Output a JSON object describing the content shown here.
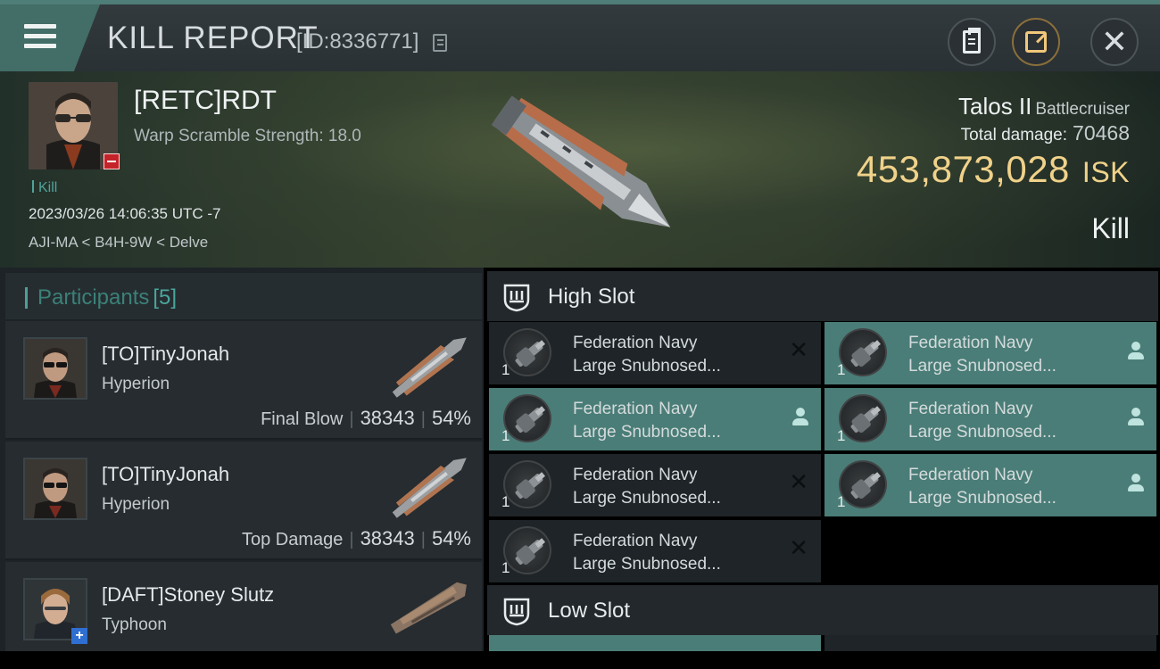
{
  "window": {
    "title": "KILL REPORT",
    "id_text": "[ID:8336771]"
  },
  "killmail": {
    "victim_name": "[RETC]RDT",
    "warp_scramble": "Warp Scramble Strength: 18.0",
    "kill_label": "Kill",
    "datetime": "2023/03/26 14:06:35 UTC -7",
    "location": "AJI-MA < B4H-9W < Delve",
    "ship_name": "Talos II",
    "ship_class": "Battlecruiser",
    "total_damage_label": "Total damage:",
    "total_damage": "70468",
    "isk_value": "453,873,028",
    "isk_unit": "ISK",
    "kill_type": "Kill"
  },
  "participants": {
    "title": "Participants",
    "count": "[5]",
    "items": [
      {
        "name": "[TO]TinyJonah",
        "ship": "Hyperion",
        "role": "Final Blow",
        "damage": "38343",
        "percent": "54%"
      },
      {
        "name": "[TO]TinyJonah",
        "ship": "Hyperion",
        "role": "Top Damage",
        "damage": "38343",
        "percent": "54%"
      },
      {
        "name": "[DAFT]Stoney Slutz",
        "ship": "Typhoon",
        "role": "",
        "damage": "",
        "percent": ""
      }
    ]
  },
  "slots": {
    "high": {
      "title": "High Slot",
      "modules": [
        {
          "line1": "Federation Navy",
          "line2": "Large Snubnosed...",
          "qty": "1",
          "state": "destroyed"
        },
        {
          "line1": "Federation Navy",
          "line2": "Large Snubnosed...",
          "qty": "1",
          "state": "dropped"
        },
        {
          "line1": "Federation Navy",
          "line2": "Large Snubnosed...",
          "qty": "1",
          "state": "dropped"
        },
        {
          "line1": "Federation Navy",
          "line2": "Large Snubnosed...",
          "qty": "1",
          "state": "dropped"
        },
        {
          "line1": "Federation Navy",
          "line2": "Large Snubnosed...",
          "qty": "1",
          "state": "destroyed"
        },
        {
          "line1": "Federation Navy",
          "line2": "Large Snubnosed...",
          "qty": "1",
          "state": "dropped"
        },
        {
          "line1": "Federation Navy",
          "line2": "Large Snubnosed...",
          "qty": "1",
          "state": "destroyed"
        }
      ]
    },
    "low": {
      "title": "Low Slot"
    }
  },
  "icons": {
    "menu": "hamburger-menu-icon",
    "copy": "copy-icon",
    "clipboard": "clipboard-icon",
    "share": "share-icon",
    "close": "close-icon",
    "slot": "slot-icon",
    "person": "person-icon",
    "destroyed": "x-icon"
  },
  "colors": {
    "accent_teal": "#4a7d77",
    "isk_gold": "#f0d28a",
    "badge_red": "#c4232a"
  }
}
